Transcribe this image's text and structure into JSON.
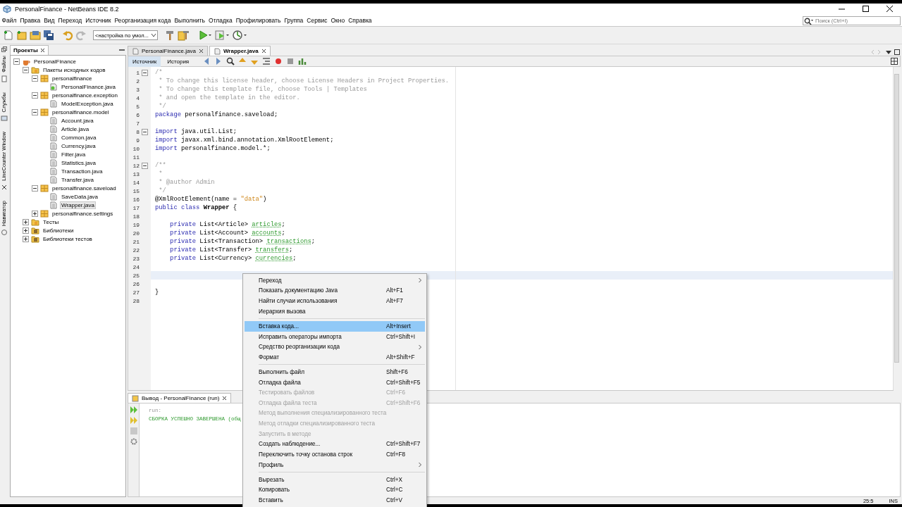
{
  "window": {
    "title": "PersonalFinance - NetBeans IDE 8.2"
  },
  "menu_bar": [
    "Файл",
    "Правка",
    "Вид",
    "Переход",
    "Источник",
    "Реорганизация кода",
    "Выполнить",
    "Отладка",
    "Профилировать",
    "Группа",
    "Сервис",
    "Окно",
    "Справка"
  ],
  "search": {
    "placeholder": "Поиск (Ctrl+I)"
  },
  "toolbar": {
    "configuration": "<настройка по умол..."
  },
  "side_strip": [
    "Файлы",
    "Службы",
    "LineCounter Window",
    "Навигатор"
  ],
  "projects": {
    "title": "Проекты",
    "tree": [
      {
        "label": "PersonalFinance",
        "kind": "project",
        "expanded": true,
        "selected": false,
        "children": [
          {
            "label": "Пакеты исходных кодов",
            "kind": "folder",
            "expanded": true,
            "selected": false,
            "children": [
              {
                "label": "personalfinance",
                "kind": "package",
                "expanded": true,
                "selected": false,
                "children": [
                  {
                    "label": "PersonalFinance.java",
                    "kind": "main-file",
                    "selected": false
                  }
                ]
              },
              {
                "label": "personalfinance.exception",
                "kind": "package",
                "expanded": true,
                "selected": false,
                "children": [
                  {
                    "label": "ModelException.java",
                    "kind": "file",
                    "selected": false
                  }
                ]
              },
              {
                "label": "personalfinance.model",
                "kind": "package",
                "expanded": true,
                "selected": false,
                "children": [
                  {
                    "label": "Account.java",
                    "kind": "file",
                    "selected": false
                  },
                  {
                    "label": "Article.java",
                    "kind": "file",
                    "selected": false
                  },
                  {
                    "label": "Common.java",
                    "kind": "file",
                    "selected": false
                  },
                  {
                    "label": "Currency.java",
                    "kind": "file",
                    "selected": false
                  },
                  {
                    "label": "Filter.java",
                    "kind": "file",
                    "selected": false
                  },
                  {
                    "label": "Statistics.java",
                    "kind": "file",
                    "selected": false
                  },
                  {
                    "label": "Transaction.java",
                    "kind": "file",
                    "selected": false
                  },
                  {
                    "label": "Transfer.java",
                    "kind": "file",
                    "selected": false
                  }
                ]
              },
              {
                "label": "personalfinance.saveload",
                "kind": "package",
                "expanded": true,
                "selected": false,
                "children": [
                  {
                    "label": "SaveData.java",
                    "kind": "file",
                    "selected": false
                  },
                  {
                    "label": "Wrapper.java",
                    "kind": "file",
                    "selected": true
                  }
                ]
              },
              {
                "label": "personalfinance.settings",
                "kind": "package",
                "expanded": false,
                "selected": false
              }
            ]
          },
          {
            "label": "Тесты",
            "kind": "folder",
            "expanded": false,
            "selected": false
          },
          {
            "label": "Библиотеки",
            "kind": "library",
            "expanded": false,
            "selected": false
          },
          {
            "label": "Библиотеки тестов",
            "kind": "library",
            "expanded": false,
            "selected": false
          }
        ]
      }
    ]
  },
  "editor": {
    "tabs": [
      {
        "label": "PersonalFinance.java",
        "selected": false
      },
      {
        "label": "Wrapper.java",
        "selected": true
      }
    ],
    "views": [
      {
        "label": "Источник",
        "selected": true
      },
      {
        "label": "История",
        "selected": false
      }
    ],
    "lines": [
      {
        "number": "1",
        "foldable": true,
        "current": false,
        "segments": [
          {
            "kind": "comment",
            "text": "/*"
          }
        ]
      },
      {
        "number": "2",
        "foldable": false,
        "current": false,
        "segments": [
          {
            "kind": "comment",
            "text": " * To change this license header, choose License Headers in Project Properties."
          }
        ]
      },
      {
        "number": "3",
        "foldable": false,
        "current": false,
        "segments": [
          {
            "kind": "comment",
            "text": " * To change this template file, choose Tools | Templates"
          }
        ]
      },
      {
        "number": "4",
        "foldable": false,
        "current": false,
        "segments": [
          {
            "kind": "comment",
            "text": " * and open the template in the editor."
          }
        ]
      },
      {
        "number": "5",
        "foldable": false,
        "current": false,
        "segments": [
          {
            "kind": "comment",
            "text": " */"
          }
        ]
      },
      {
        "number": "6",
        "foldable": false,
        "current": false,
        "segments": [
          {
            "kind": "keyword",
            "text": "package"
          },
          {
            "kind": "plain",
            "text": " personalfinance.saveload;"
          }
        ]
      },
      {
        "number": "7",
        "foldable": false,
        "current": false
      },
      {
        "number": "8",
        "foldable": true,
        "current": false,
        "segments": [
          {
            "kind": "keyword",
            "text": "import"
          },
          {
            "kind": "plain",
            "text": " java.util.List;"
          }
        ]
      },
      {
        "number": "9",
        "foldable": false,
        "current": false,
        "segments": [
          {
            "kind": "keyword",
            "text": "import"
          },
          {
            "kind": "plain",
            "text": " javax.xml.bind.annotation.XmlRootElement;"
          }
        ]
      },
      {
        "number": "10",
        "foldable": false,
        "current": false,
        "segments": [
          {
            "kind": "keyword",
            "text": "import"
          },
          {
            "kind": "plain",
            "text": " personalfinance.model.*;"
          }
        ]
      },
      {
        "number": "11",
        "foldable": false,
        "current": false
      },
      {
        "number": "12",
        "foldable": true,
        "current": false,
        "segments": [
          {
            "kind": "comment",
            "text": "/**"
          }
        ]
      },
      {
        "number": "13",
        "foldable": false,
        "current": false,
        "segments": [
          {
            "kind": "comment",
            "text": " *"
          }
        ]
      },
      {
        "number": "14",
        "foldable": false,
        "current": false,
        "segments": [
          {
            "kind": "comment",
            "text": " * @author Admin"
          }
        ]
      },
      {
        "number": "15",
        "foldable": false,
        "current": false,
        "segments": [
          {
            "kind": "comment",
            "text": " */"
          }
        ]
      },
      {
        "number": "16",
        "foldable": false,
        "current": false,
        "segments": [
          {
            "kind": "plain",
            "text": "@XmlRootElement(name = "
          },
          {
            "kind": "string",
            "text": "\"data\""
          },
          {
            "kind": "plain",
            "text": ")"
          }
        ]
      },
      {
        "number": "17",
        "foldable": false,
        "current": false,
        "segments": [
          {
            "kind": "keyword",
            "text": "public class "
          },
          {
            "kind": "declaration",
            "text": "Wrapper"
          },
          {
            "kind": "plain",
            "text": " {"
          }
        ]
      },
      {
        "number": "18",
        "foldable": false,
        "current": false
      },
      {
        "number": "19",
        "foldable": false,
        "current": false,
        "segments": [
          {
            "kind": "keyword",
            "text": "    private"
          },
          {
            "kind": "plain",
            "text": " List<Article> "
          },
          {
            "kind": "field",
            "text": "articles"
          },
          {
            "kind": "plain",
            "text": ";"
          }
        ]
      },
      {
        "number": "20",
        "foldable": false,
        "current": false,
        "segments": [
          {
            "kind": "keyword",
            "text": "    private"
          },
          {
            "kind": "plain",
            "text": " List<Account> "
          },
          {
            "kind": "field",
            "text": "accounts"
          },
          {
            "kind": "plain",
            "text": ";"
          }
        ]
      },
      {
        "number": "21",
        "foldable": false,
        "current": false,
        "segments": [
          {
            "kind": "keyword",
            "text": "    private"
          },
          {
            "kind": "plain",
            "text": " List<Transaction> "
          },
          {
            "kind": "field",
            "text": "transactions"
          },
          {
            "kind": "plain",
            "text": ";"
          }
        ]
      },
      {
        "number": "22",
        "foldable": false,
        "current": false,
        "segments": [
          {
            "kind": "keyword",
            "text": "    private"
          },
          {
            "kind": "plain",
            "text": " List<Transfer> "
          },
          {
            "kind": "field",
            "text": "transfers"
          },
          {
            "kind": "plain",
            "text": ";"
          }
        ]
      },
      {
        "number": "23",
        "foldable": false,
        "current": false,
        "segments": [
          {
            "kind": "keyword",
            "text": "    private"
          },
          {
            "kind": "plain",
            "text": " List<Currency> "
          },
          {
            "kind": "field",
            "text": "currencies"
          },
          {
            "kind": "plain",
            "text": ";"
          }
        ]
      },
      {
        "number": "24",
        "foldable": false,
        "current": false
      },
      {
        "number": "25",
        "foldable": false,
        "current": true
      },
      {
        "number": "26",
        "foldable": false,
        "current": false
      },
      {
        "number": "27",
        "foldable": false,
        "current": false,
        "segments": [
          {
            "kind": "plain",
            "text": "}"
          }
        ]
      },
      {
        "number": "28",
        "foldable": false,
        "current": false
      }
    ]
  },
  "output": {
    "title": "Вывод - PersonalFinance (run)",
    "lines": [
      {
        "kind": "info",
        "text": "run:"
      },
      {
        "kind": "success",
        "text": "СБОРКА УСПЕШНО ЗАВЕРШЕНА (общ"
      }
    ]
  },
  "context_menu": [
    {
      "kind": "item",
      "label": "Переход",
      "submenu": true,
      "disabled": false,
      "selected": false
    },
    {
      "kind": "item",
      "label": "Показать документацию Java",
      "shortcut": "Alt+F1",
      "submenu": false,
      "disabled": false,
      "selected": false
    },
    {
      "kind": "item",
      "label": "Найти случаи использования",
      "shortcut": "Alt+F7",
      "submenu": false,
      "disabled": false,
      "selected": false
    },
    {
      "kind": "item",
      "label": "Иерархия вызова",
      "submenu": false,
      "disabled": false,
      "selected": false
    },
    {
      "kind": "separator"
    },
    {
      "kind": "item",
      "label": "Вставка кода...",
      "shortcut": "Alt+Insert",
      "submenu": false,
      "disabled": false,
      "selected": true
    },
    {
      "kind": "item",
      "label": "Исправить операторы импорта",
      "shortcut": "Ctrl+Shift+I",
      "submenu": false,
      "disabled": false,
      "selected": false
    },
    {
      "kind": "item",
      "label": "Средство реорганизации кода",
      "submenu": true,
      "disabled": false,
      "selected": false
    },
    {
      "kind": "item",
      "label": "Формат",
      "shortcut": "Alt+Shift+F",
      "submenu": false,
      "disabled": false,
      "selected": false
    },
    {
      "kind": "separator"
    },
    {
      "kind": "item",
      "label": "Выполнить файл",
      "shortcut": "Shift+F6",
      "submenu": false,
      "disabled": false,
      "selected": false
    },
    {
      "kind": "item",
      "label": "Отладка файла",
      "shortcut": "Ctrl+Shift+F5",
      "submenu": false,
      "disabled": false,
      "selected": false
    },
    {
      "kind": "item",
      "label": "Тестировать файлов",
      "shortcut": "Ctrl+F6",
      "submenu": false,
      "disabled": true,
      "selected": false
    },
    {
      "kind": "item",
      "label": "Отладка файла теста",
      "shortcut": "Ctrl+Shift+F6",
      "submenu": false,
      "disabled": true,
      "selected": false
    },
    {
      "kind": "item",
      "label": "Метод выполнения специализированного теста",
      "submenu": false,
      "disabled": true,
      "selected": false
    },
    {
      "kind": "item",
      "label": "Метод отладки специализированного теста",
      "submenu": false,
      "disabled": true,
      "selected": false
    },
    {
      "kind": "item",
      "label": "Запустить в методе",
      "submenu": false,
      "disabled": true,
      "selected": false
    },
    {
      "kind": "item",
      "label": "Создать наблюдение...",
      "shortcut": "Ctrl+Shift+F7",
      "submenu": false,
      "disabled": false,
      "selected": false
    },
    {
      "kind": "item",
      "label": "Переключить точку останова строк",
      "shortcut": "Ctrl+F8",
      "submenu": false,
      "disabled": false,
      "selected": false
    },
    {
      "kind": "item",
      "label": "Профиль",
      "submenu": true,
      "disabled": false,
      "selected": false
    },
    {
      "kind": "separator"
    },
    {
      "kind": "item",
      "label": "Вырезать",
      "shortcut": "Ctrl+X",
      "submenu": false,
      "disabled": false,
      "selected": false
    },
    {
      "kind": "item",
      "label": "Копировать",
      "shortcut": "Ctrl+C",
      "submenu": false,
      "disabled": false,
      "selected": false
    },
    {
      "kind": "item",
      "label": "Вставить",
      "shortcut": "Ctrl+V",
      "submenu": false,
      "disabled": false,
      "selected": false
    }
  ],
  "status_bar": {
    "position": "25:5",
    "mode": "INS"
  }
}
